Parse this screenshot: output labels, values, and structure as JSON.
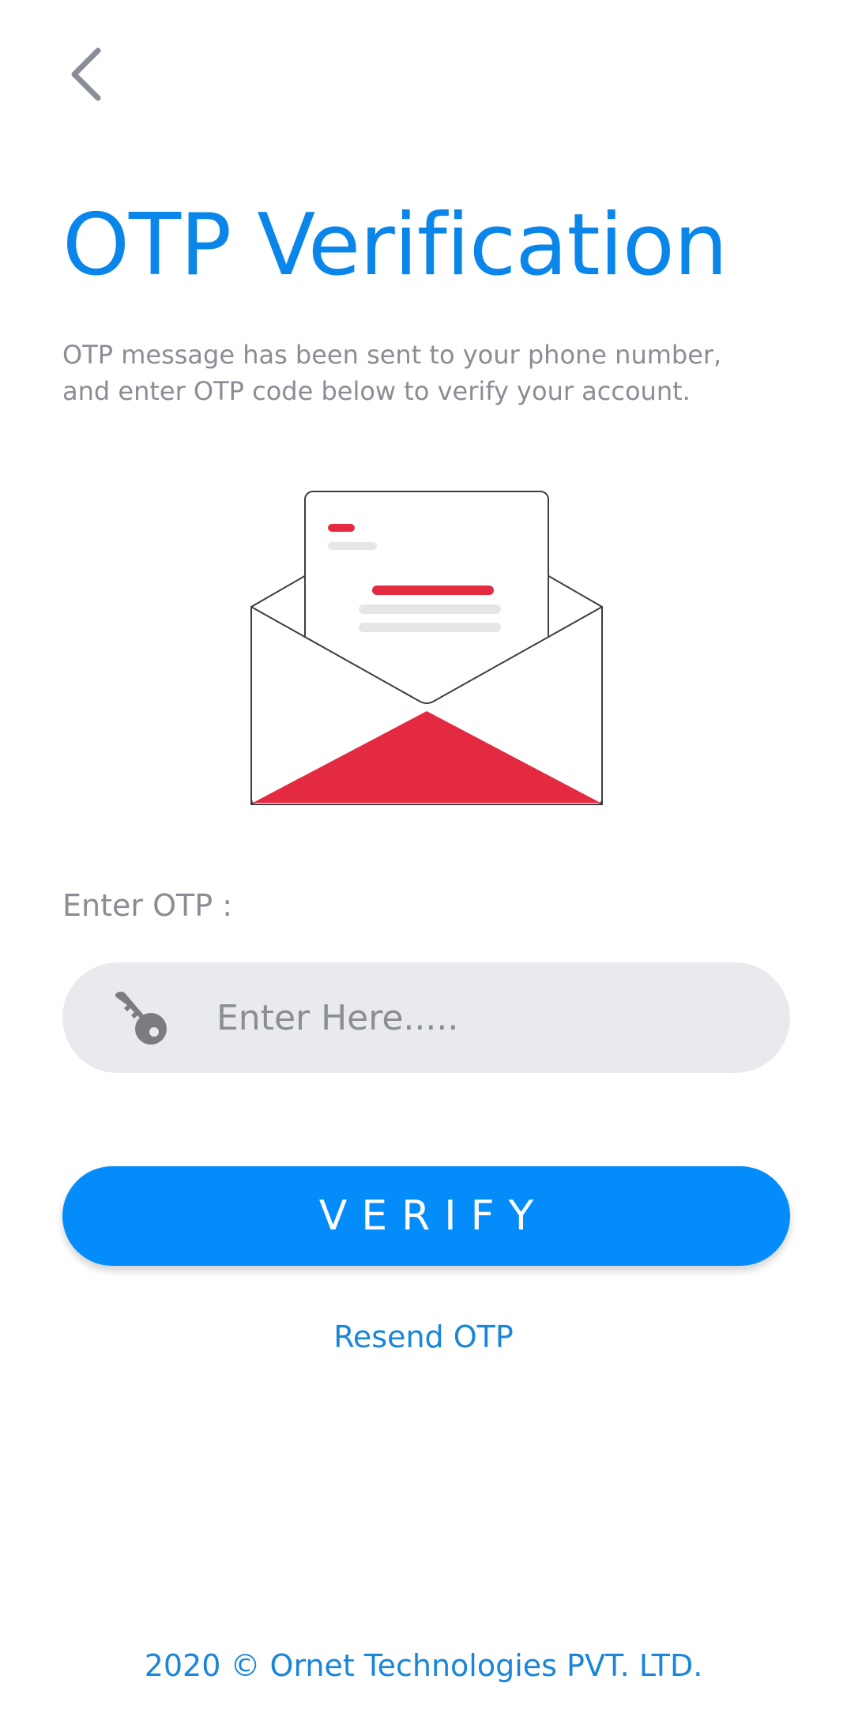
{
  "header": {
    "back_icon": "chevron-left-icon"
  },
  "title": "OTP Verification",
  "subtitle": "OTP message has been sent to your phone number, and enter OTP code below to verify your account.",
  "illustration": "open-envelope-with-letter",
  "otp": {
    "label": "Enter OTP :",
    "placeholder": "Enter Here.....",
    "value": "",
    "icon": "key-icon"
  },
  "verify_label": "VERIFY",
  "resend_label": "Resend OTP",
  "footer": "2020 © Ornet Technologies PVT. LTD.",
  "colors": {
    "accent": "#048cfb",
    "title": "#0a86ea",
    "link": "#1a86d8",
    "envelope_red": "#e32a40",
    "field_bg": "#e8eaed",
    "muted_text": "#8a8d94"
  }
}
